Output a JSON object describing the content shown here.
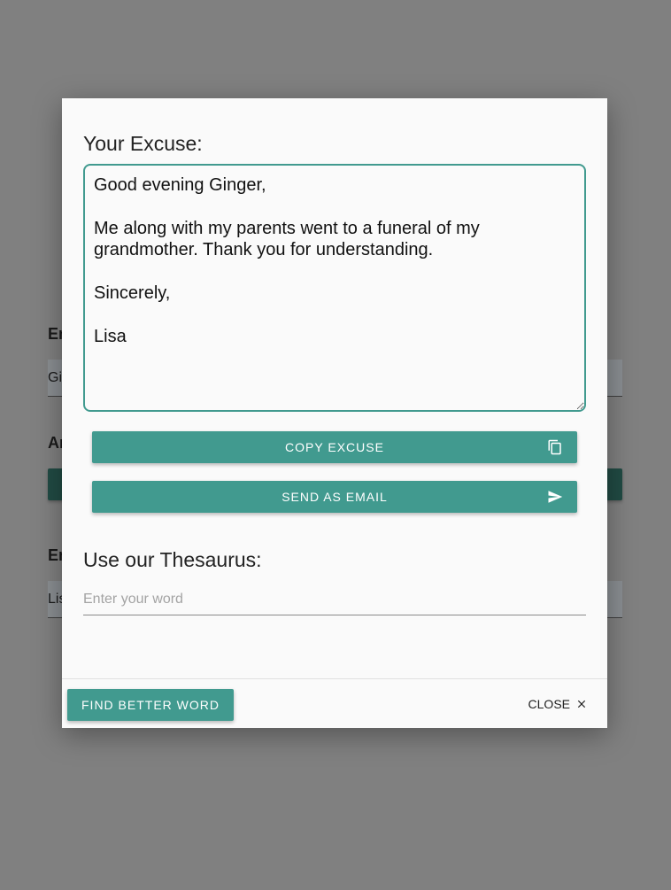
{
  "background": {
    "label_1": "Em",
    "field_1": "Gi",
    "label_2": "An",
    "label_3": "Em",
    "field_3": "Lis"
  },
  "modal": {
    "title": "Your Excuse:",
    "excuse_text": "Good evening Ginger,\n\nMe along with my parents went to a funeral of my grandmother. Thank you for understanding.\n\nSincerely,\n\nLisa",
    "copy_button": "COPY EXCUSE",
    "email_button": "SEND AS EMAIL",
    "thesaurus_title": "Use our Thesaurus:",
    "word_placeholder": "Enter your word",
    "find_button": "FIND BETTER WORD",
    "close_button": "CLOSE"
  },
  "icons": {
    "copy": "copy-icon",
    "send": "send-icon",
    "close": "close-icon"
  },
  "colors": {
    "accent": "#419a8f",
    "overlay": "#808080"
  }
}
